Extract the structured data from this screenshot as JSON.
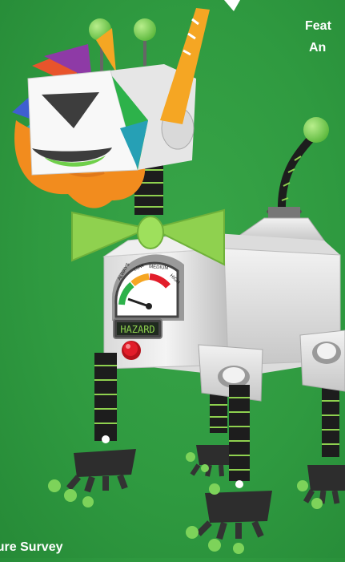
{
  "header": {
    "caption_line1": "Feat",
    "caption_line2": "An"
  },
  "footer": {
    "caption": "iture Survey"
  },
  "robot": {
    "gauge_labels": [
      "ALWAYS",
      "LOW",
      "MEDIUM",
      "HIGH"
    ],
    "display_text": "HAZARD"
  },
  "colors": {
    "background": "#2f9a40",
    "bow_tie": "#8fd14f",
    "beard": "#f28c1e",
    "antenna_ball": "#7dd35a",
    "body": "#e6e6e6",
    "button": "#e21d2a"
  }
}
